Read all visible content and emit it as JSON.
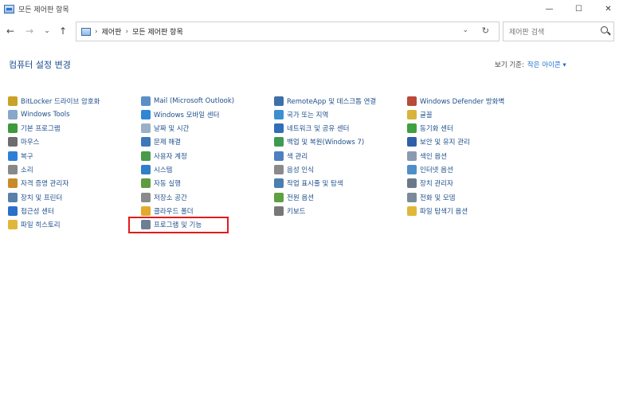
{
  "window": {
    "title": "모든 제어판 항목",
    "controls": {
      "minimize": "—",
      "maximize": "☐",
      "close": "✕"
    }
  },
  "nav": {
    "back": "←",
    "forward": "→",
    "recent": "⌄",
    "up": "↑"
  },
  "address": {
    "sep1": "›",
    "crumb1": "제어판",
    "sep2": "›",
    "crumb2": "모든 제어판 항목",
    "dropdown": "⌄",
    "refresh": "↻"
  },
  "search": {
    "placeholder": "제어판 검색"
  },
  "header": {
    "title": "컴퓨터 설정 변경",
    "viewby_label": "보기 기준:",
    "viewby_value": "작은 아이콘 ▾"
  },
  "columns": [
    {
      "items": [
        {
          "label": "BitLocker 드라이브 암호화",
          "color": "#c9a227"
        },
        {
          "label": "Windows Tools",
          "color": "#8aa6c8"
        },
        {
          "label": "기본 프로그램",
          "color": "#3c9a3c"
        },
        {
          "label": "마우스",
          "color": "#6d6d6d"
        },
        {
          "label": "복구",
          "color": "#2e7fd6"
        },
        {
          "label": "소리",
          "color": "#888888"
        },
        {
          "label": "자격 증명 관리자",
          "color": "#c98a2a"
        },
        {
          "label": "장치 및 프린터",
          "color": "#5a7fa8"
        },
        {
          "label": "접근성 센터",
          "color": "#2a6fc9"
        },
        {
          "label": "파일 히스토리",
          "color": "#e0b73a"
        }
      ]
    },
    {
      "items": [
        {
          "label": "Mail (Microsoft Outlook)",
          "color": "#5d8fc6"
        },
        {
          "label": "Windows 모바일 센터",
          "color": "#2f86d4"
        },
        {
          "label": "날짜 및 시간",
          "color": "#9ab0c8"
        },
        {
          "label": "문제 해결",
          "color": "#3d78b8"
        },
        {
          "label": "사용자 계정",
          "color": "#4a9a4a"
        },
        {
          "label": "시스템",
          "color": "#2f7fc9"
        },
        {
          "label": "자동 실행",
          "color": "#5f9a3f"
        },
        {
          "label": "저장소 공간",
          "color": "#8a8a8a"
        },
        {
          "label": "클라우드 폴더",
          "color": "#e2a92e"
        },
        {
          "label": "프로그램 및 기능",
          "color": "#6c7f95"
        }
      ]
    },
    {
      "items": [
        {
          "label": "RemoteApp 및 데스크톱 연결",
          "color": "#3f6fa8"
        },
        {
          "label": "국가 또는 지역",
          "color": "#3c8fd0"
        },
        {
          "label": "네트워크 및 공유 센터",
          "color": "#2f6fb8"
        },
        {
          "label": "백업 및 복원(Windows 7)",
          "color": "#3f9a4f"
        },
        {
          "label": "색 관리",
          "color": "#4f7fc0"
        },
        {
          "label": "음성 인식",
          "color": "#8a8a8a"
        },
        {
          "label": "작업 표시줄 및 탐색",
          "color": "#4a7fb0"
        },
        {
          "label": "전원 옵션",
          "color": "#5fa040"
        },
        {
          "label": "키보드",
          "color": "#777777"
        }
      ]
    },
    {
      "items": [
        {
          "label": "Windows Defender 방화벽",
          "color": "#b84a3a"
        },
        {
          "label": "글꼴",
          "color": "#d9b33a"
        },
        {
          "label": "동기화 센터",
          "color": "#3fa03f"
        },
        {
          "label": "보안 및 유지 관리",
          "color": "#2f5fa8"
        },
        {
          "label": "색인 옵션",
          "color": "#8a9ab0"
        },
        {
          "label": "인터넷 옵션",
          "color": "#4f8fc8"
        },
        {
          "label": "장치 관리자",
          "color": "#6a7a8a"
        },
        {
          "label": "전화 및 모뎀",
          "color": "#7a8a9a"
        },
        {
          "label": "파일 탐색기 옵션",
          "color": "#e0b73a"
        }
      ]
    }
  ]
}
